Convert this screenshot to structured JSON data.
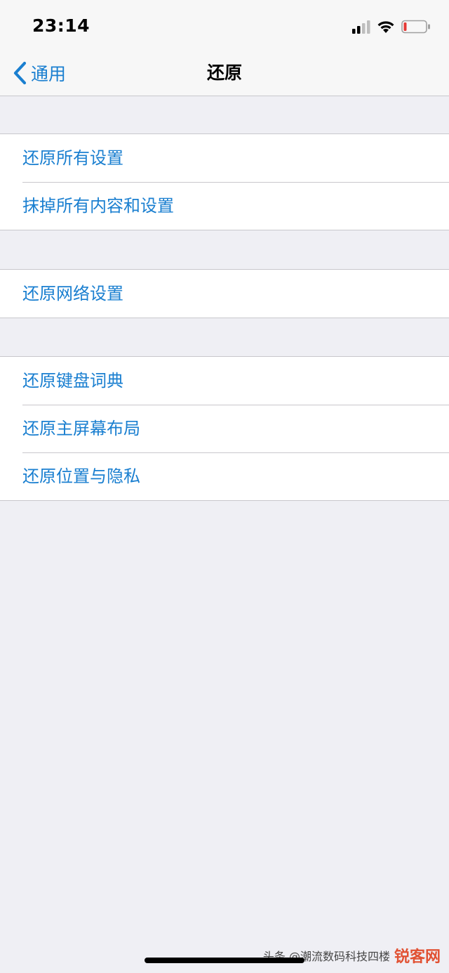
{
  "status_bar": {
    "time": "23:14",
    "icons": [
      "cellular-signal-icon",
      "wifi-icon",
      "battery-low-icon"
    ],
    "battery_color": "#e53935"
  },
  "nav": {
    "back_label": "通用",
    "title": "还原",
    "accent_color": "#1a7fd0"
  },
  "groups": [
    {
      "items": [
        {
          "label": "还原所有设置"
        },
        {
          "label": "抹掉所有内容和设置"
        }
      ]
    },
    {
      "items": [
        {
          "label": "还原网络设置"
        }
      ]
    },
    {
      "items": [
        {
          "label": "还原键盘词典"
        },
        {
          "label": "还原主屏幕布局"
        },
        {
          "label": "还原位置与隐私"
        }
      ]
    }
  ],
  "watermark": {
    "source": "头条 @潮流数码科技四楼",
    "logo": "锐客网"
  }
}
